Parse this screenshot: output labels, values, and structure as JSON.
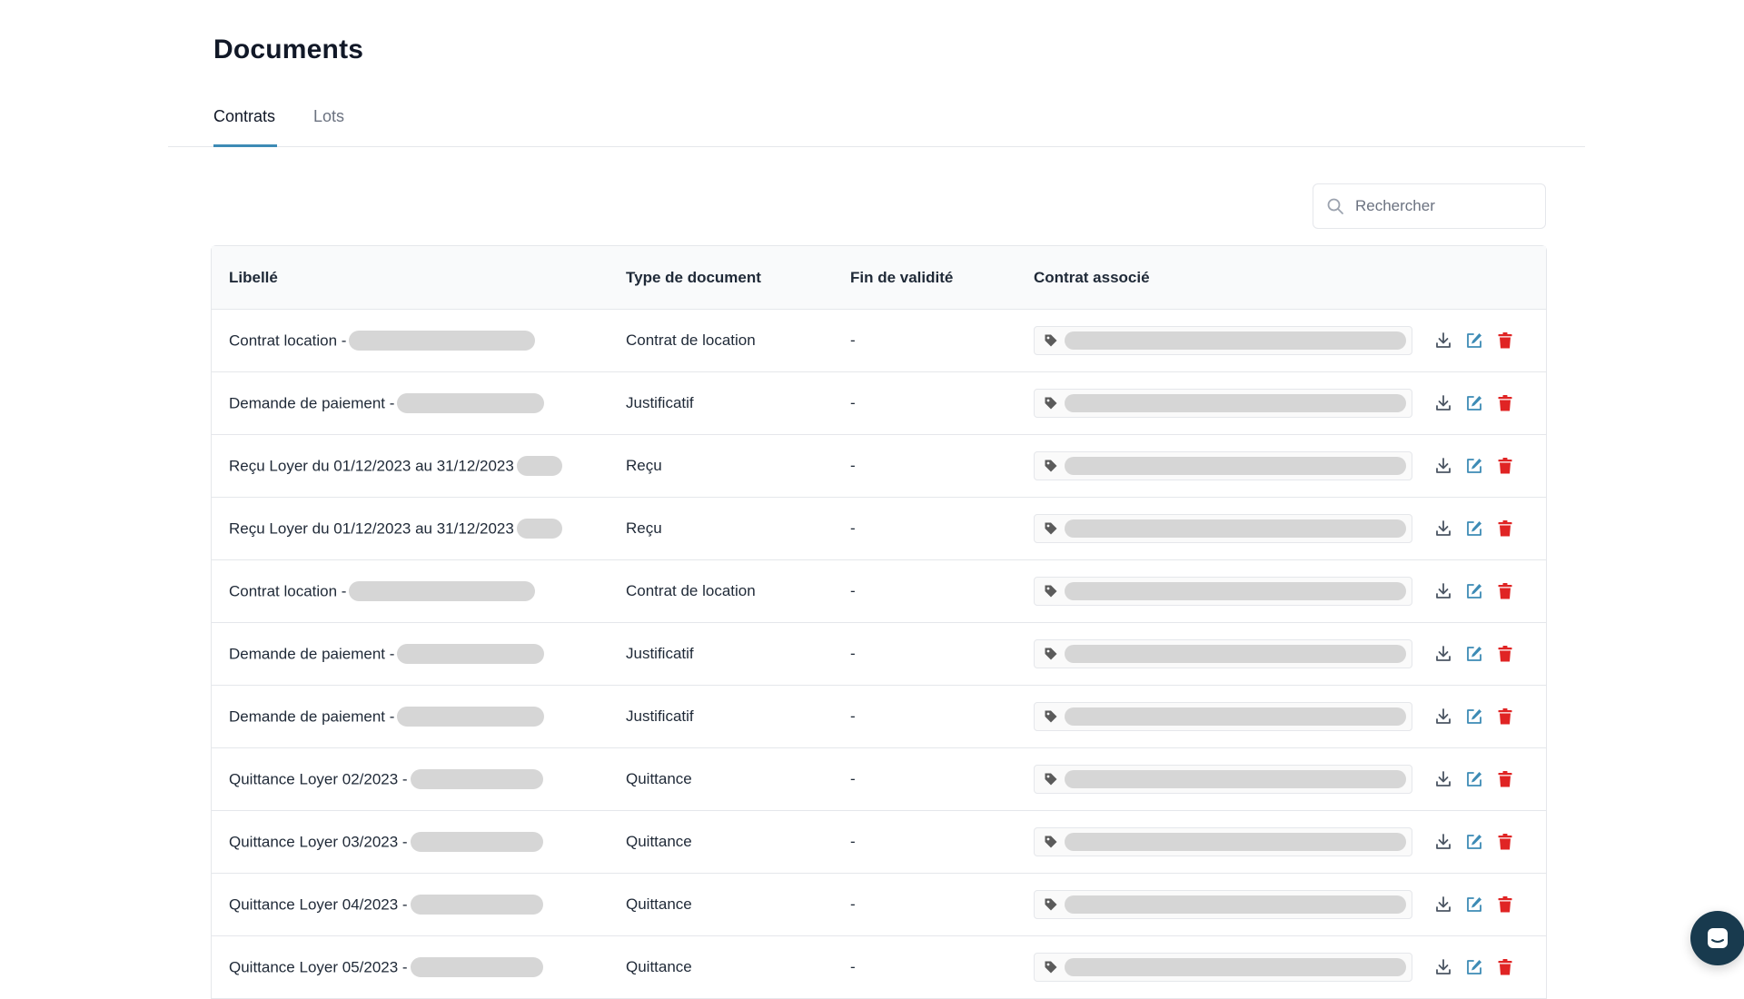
{
  "page": {
    "title": "Documents"
  },
  "tabs": [
    {
      "label": "Contrats",
      "active": true
    },
    {
      "label": "Lots",
      "active": false
    }
  ],
  "search": {
    "placeholder": "Rechercher",
    "value": ""
  },
  "table": {
    "columns": [
      "Libellé",
      "Type de document",
      "Fin de validité",
      "Contrat associé"
    ],
    "rows": [
      {
        "libelle": "Contrat location -",
        "type": "Contrat de location",
        "fin": "-"
      },
      {
        "libelle": "Demande de paiement -",
        "type": "Justificatif",
        "fin": "-"
      },
      {
        "libelle": "Reçu Loyer du 01/12/2023 au 31/12/2023",
        "type": "Reçu",
        "fin": "-"
      },
      {
        "libelle": "Reçu Loyer du 01/12/2023 au 31/12/2023",
        "type": "Reçu",
        "fin": "-"
      },
      {
        "libelle": "Contrat location -",
        "type": "Contrat de location",
        "fin": "-"
      },
      {
        "libelle": "Demande de paiement -",
        "type": "Justificatif",
        "fin": "-"
      },
      {
        "libelle": "Demande de paiement -",
        "type": "Justificatif",
        "fin": "-"
      },
      {
        "libelle": "Quittance Loyer 02/2023 -",
        "type": "Quittance",
        "fin": "-"
      },
      {
        "libelle": "Quittance Loyer 03/2023 -",
        "type": "Quittance",
        "fin": "-"
      },
      {
        "libelle": "Quittance Loyer 04/2023 -",
        "type": "Quittance",
        "fin": "-"
      },
      {
        "libelle": "Quittance Loyer 05/2023 -",
        "type": "Quittance",
        "fin": "-"
      }
    ],
    "row_actions": [
      "download-icon",
      "edit-icon",
      "trash-icon"
    ]
  },
  "icons": {
    "search": "search-icon",
    "tag": "tag-icon",
    "chat": "chat-icon"
  },
  "colors": {
    "accent": "#3d8bb5",
    "download": "#4b5563",
    "edit": "#3d8bb5",
    "delete": "#e02424",
    "chat_button": "#183a4e",
    "redacted": "#d6d6d6"
  }
}
